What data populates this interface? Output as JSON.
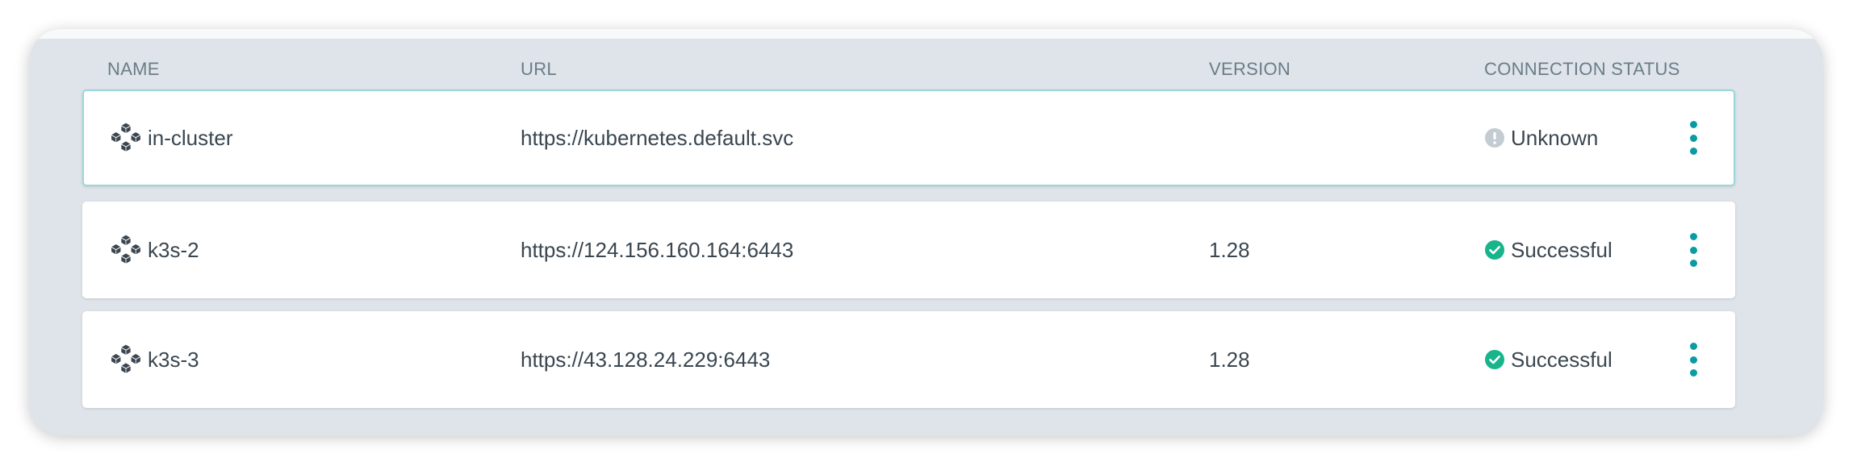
{
  "table": {
    "headers": {
      "name": "NAME",
      "url": "URL",
      "version": "VERSION",
      "status": "CONNECTION STATUS"
    },
    "rows": [
      {
        "name": "in-cluster",
        "url": "https://kubernetes.default.svc",
        "version": "",
        "status": "Unknown",
        "status_icon": "info-circle-icon",
        "selected": true
      },
      {
        "name": "k3s-2",
        "url": "https://124.156.160.164:6443",
        "version": "1.28",
        "status": "Successful",
        "status_icon": "check-circle-icon",
        "selected": false
      },
      {
        "name": "k3s-3",
        "url": "https://43.128.24.229:6443",
        "version": "1.28",
        "status": "Successful",
        "status_icon": "check-circle-icon",
        "selected": false
      }
    ]
  },
  "colors": {
    "accent": "#0a9aa6",
    "success": "#18b48c",
    "unknown": "#c3ccd3",
    "panel_background": "#dee4e9",
    "selected_border": "#9ad7db"
  }
}
